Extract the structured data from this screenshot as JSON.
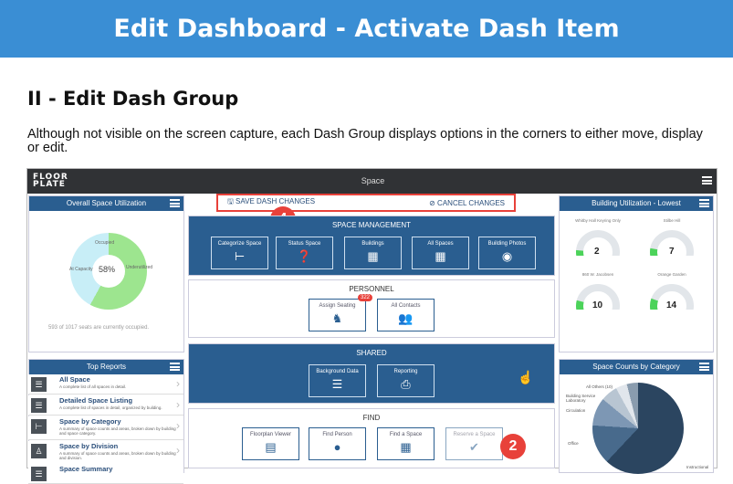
{
  "header": {
    "title": "Edit Dashboard - Activate Dash Item"
  },
  "section": {
    "title": "II - Edit Dash Group",
    "description": "Although not visible on the screen capture, each Dash Group displays options in the corners to either move, display or edit."
  },
  "app": {
    "logo_line1": "FLOOR",
    "logo_line2": "PLATE",
    "title": "Space"
  },
  "utilization": {
    "title": "Overall Space Utilization",
    "center": "58%",
    "label_occupied": "Occupied",
    "label_capacity": "At Capacity",
    "label_underutilized": "Underutilized",
    "footer": "593 of 1017 seats are currently occupied."
  },
  "editbar": {
    "save": "SAVE DASH CHANGES",
    "cancel": "CANCEL CHANGES"
  },
  "callouts": {
    "a": "4",
    "b": "2"
  },
  "space_mgmt": {
    "title": "SPACE MANAGEMENT",
    "tiles": [
      "Categorize Space",
      "Status Space",
      "Buildings",
      "All Spaces",
      "Building Photos"
    ]
  },
  "personnel": {
    "title": "PERSONNEL",
    "tiles": [
      "Assign Seating",
      "All Contacts"
    ],
    "badge": "322"
  },
  "shared": {
    "title": "SHARED",
    "tiles": [
      "Background Data",
      "Reporting"
    ]
  },
  "find": {
    "title": "FIND",
    "tiles": [
      "Floorplan Viewer",
      "Find Person",
      "Find a Space",
      "Reserve a Space"
    ]
  },
  "building_util": {
    "title": "Building Utilization - Lowest",
    "gauges": [
      {
        "name": "Whitby Hall Keyring Only",
        "value": "2",
        "min": "0",
        "max": "100"
      },
      {
        "name": "Stilbe Hill",
        "value": "7",
        "min": "0",
        "max": "100"
      },
      {
        "name": "860 W. Jacobsen",
        "value": "10",
        "min": "0",
        "max": "100"
      },
      {
        "name": "Orange Garden",
        "value": "14",
        "min": "0",
        "max": "100"
      }
    ]
  },
  "reports": {
    "title": "Top Reports",
    "items": [
      {
        "title": "All Space",
        "desc": "A complete list of all spaces in detail."
      },
      {
        "title": "Detailed Space Listing",
        "desc": "A complete list of spaces in detail, organized by building."
      },
      {
        "title": "Space by Category",
        "desc": "A summary of space counts and areas, broken down by building and space category."
      },
      {
        "title": "Space by Division",
        "desc": "A summary of space counts and areas, broken down by building and division."
      },
      {
        "title": "Space Summary",
        "desc": ""
      }
    ]
  },
  "category": {
    "title": "Space Counts by Category",
    "labels": [
      "All Others (10)",
      "Building Service Laboratory",
      "Circulation",
      "Office",
      "Instructional"
    ]
  }
}
